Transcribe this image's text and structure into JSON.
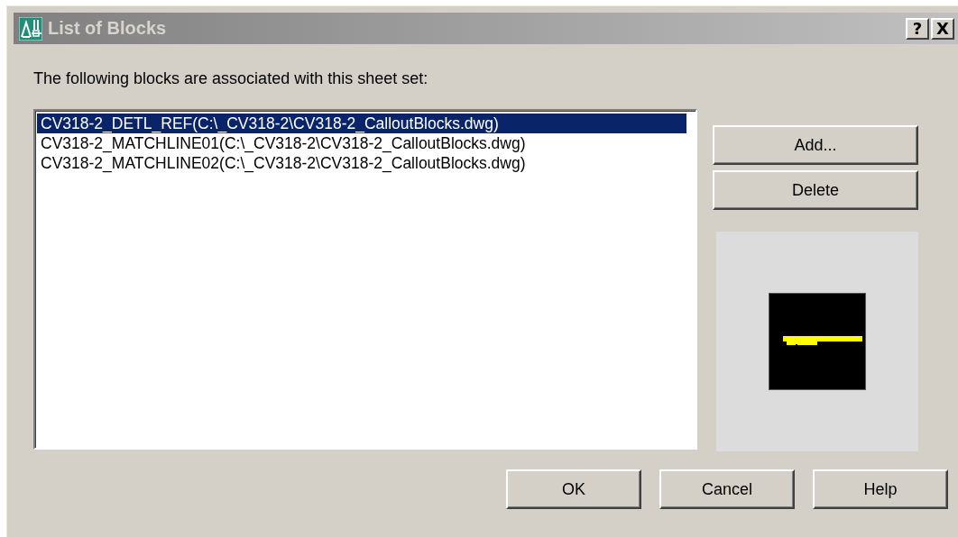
{
  "window": {
    "title": "List of Blocks",
    "title_buttons": [
      "?",
      "X"
    ]
  },
  "intro": "The following blocks are associated with this sheet set:",
  "blocks": [
    {
      "label": "CV318-2_DETL_REF(C:\\_CV318-2\\CV318-2_CalloutBlocks.dwg)",
      "selected": true
    },
    {
      "label": "CV318-2_MATCHLINE01(C:\\_CV318-2\\CV318-2_CalloutBlocks.dwg)",
      "selected": false
    },
    {
      "label": "CV318-2_MATCHLINE02(C:\\_CV318-2\\CV318-2_CalloutBlocks.dwg)",
      "selected": false
    }
  ],
  "side_buttons": [
    "Add...",
    "Delete"
  ],
  "buttons": [
    "OK",
    "Cancel",
    "Help"
  ]
}
